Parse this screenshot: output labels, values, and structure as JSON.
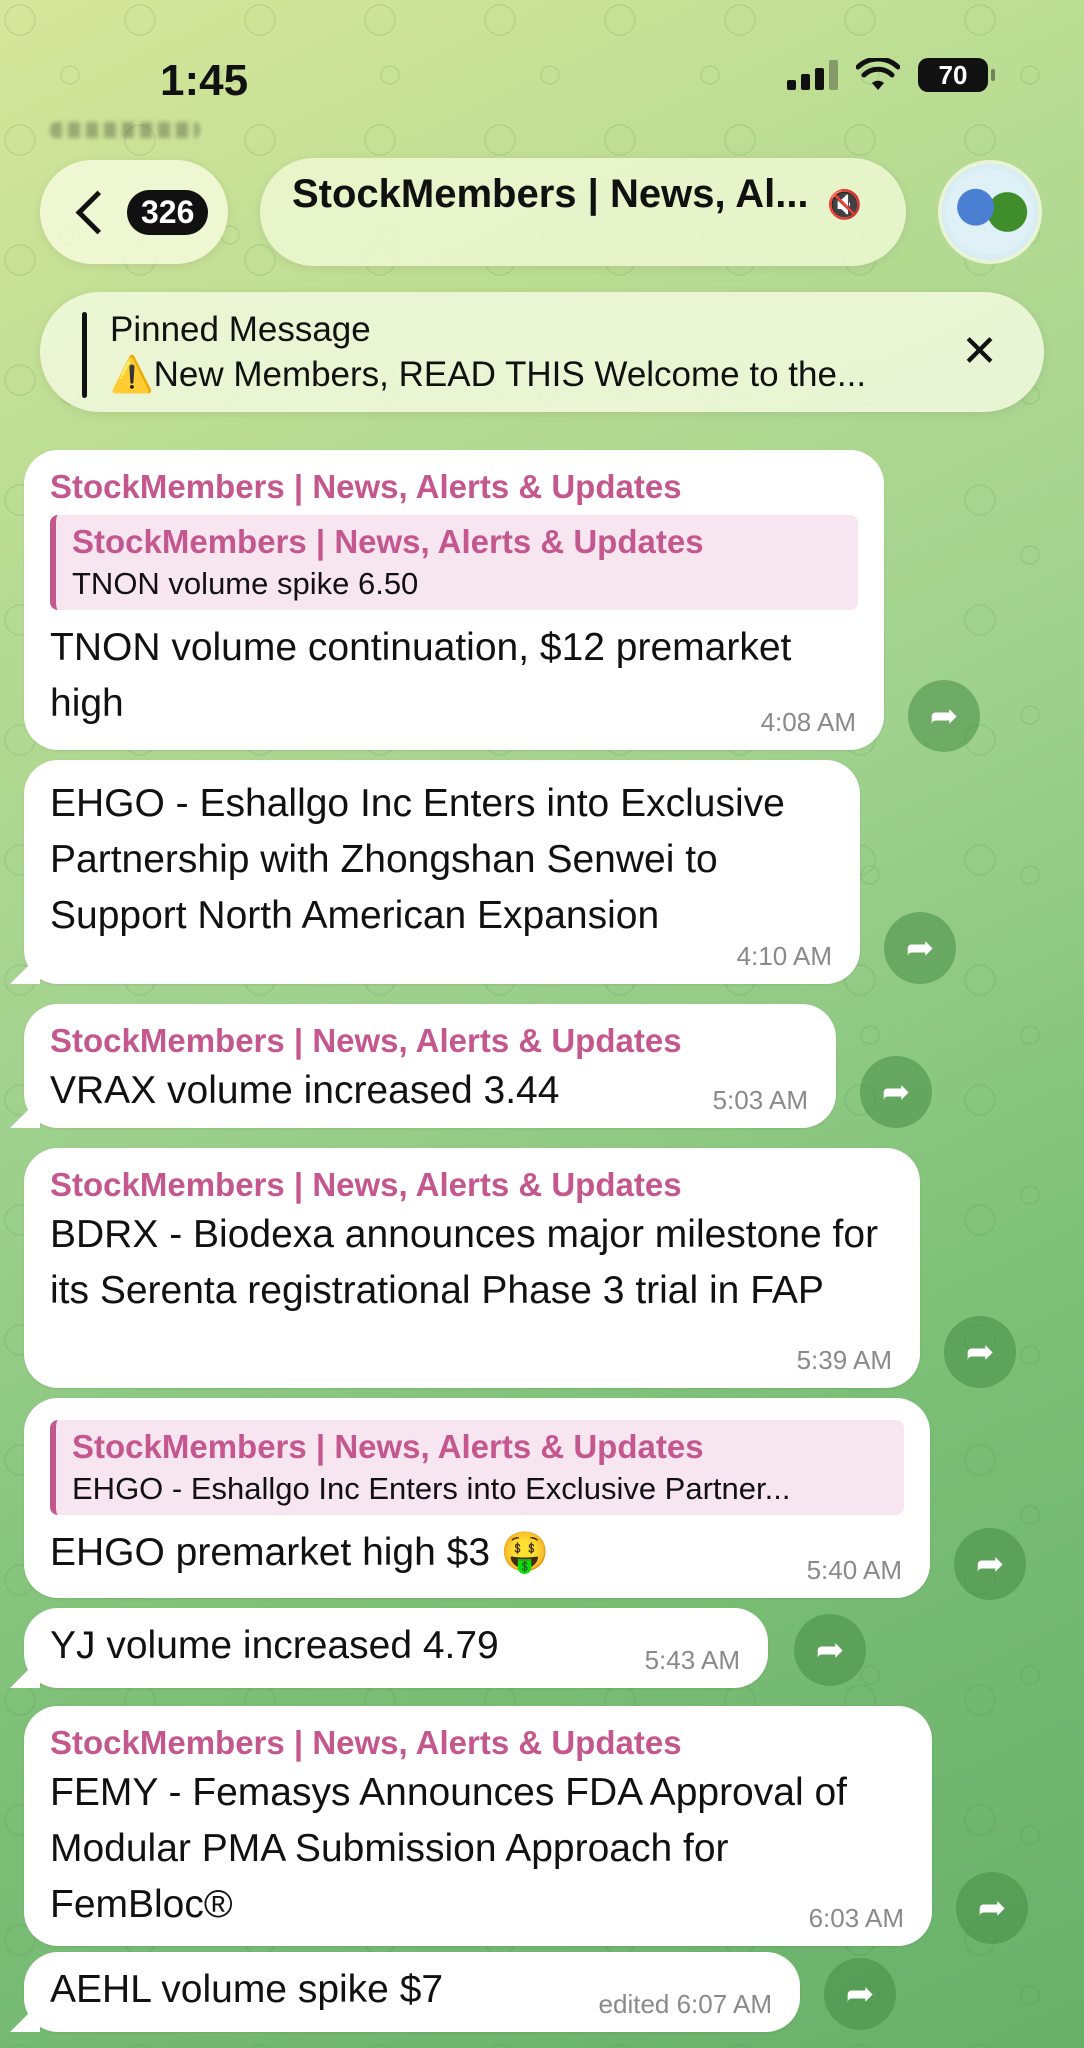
{
  "status_bar": {
    "time": "1:45",
    "battery": "70"
  },
  "header": {
    "back_count": "326",
    "title": "StockMembers | News, Al...",
    "mute_icon": "muted-bell-icon"
  },
  "pinned": {
    "title": "Pinned Message",
    "text": "⚠️New Members, READ THIS Welcome to the..."
  },
  "messages": [
    {
      "sender": "StockMembers | News, Alerts & Updates",
      "quote_sender": "StockMembers | News, Alerts & Updates",
      "quote_text": "TNON volume spike 6.50",
      "text": "TNON volume continuation, $12 premarket high",
      "time": "4:08 AM"
    },
    {
      "text": "EHGO - Eshallgo Inc Enters into Exclusive Partnership with Zhongshan Senwei to Support North American Expansion",
      "time": "4:10 AM"
    },
    {
      "sender": "StockMembers | News, Alerts & Updates",
      "text": "VRAX volume increased 3.44",
      "time": "5:03 AM"
    },
    {
      "sender": "StockMembers | News, Alerts & Updates",
      "text": "BDRX  - Biodexa announces major milestone for its Serenta registrational Phase 3 trial in FAP",
      "time": "5:39 AM"
    },
    {
      "quote_sender": "StockMembers | News, Alerts & Updates",
      "quote_text": "EHGO - Eshallgo Inc Enters into Exclusive Partner...",
      "text": "EHGO premarket high $3 🤑",
      "time": "5:40 AM"
    },
    {
      "text": "YJ volume increased 4.79",
      "time": "5:43 AM"
    },
    {
      "sender": "StockMembers | News, Alerts & Updates",
      "text": "FEMY - Femasys Announces FDA Approval of Modular PMA Submission Approach for FemBloc®",
      "time": "6:03 AM"
    },
    {
      "text": "AEHL volume spike $7",
      "time": "edited 6:07 AM"
    }
  ]
}
